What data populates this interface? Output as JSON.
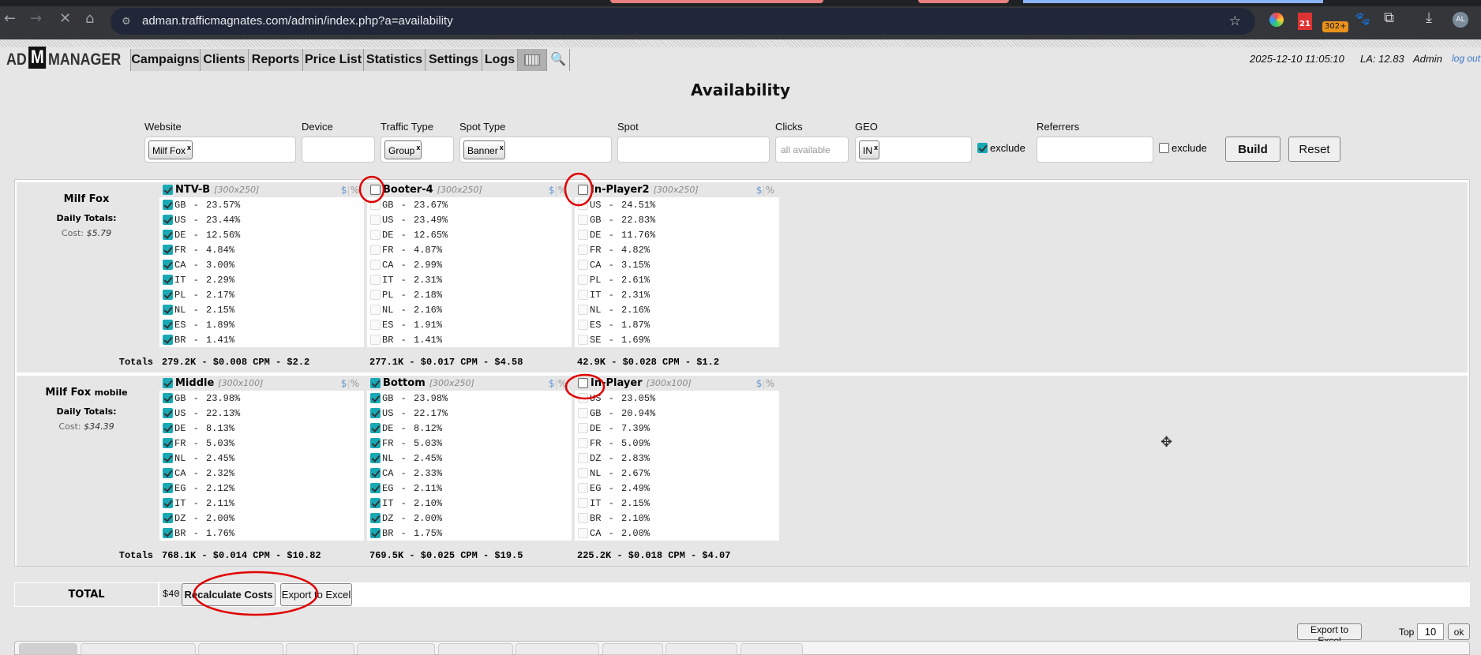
{
  "browser": {
    "url": "adman.trafficmagnates.com/admin/index.php?a=availability",
    "badge_calendar": "21",
    "badge_ext": "302+",
    "avatar": "AL"
  },
  "nav": {
    "logo": "AD M MANAGER",
    "logo_parts": [
      "AD",
      "M",
      "MANAGER"
    ],
    "items": [
      "Campaigns",
      "Clients",
      "Reports",
      "Price List",
      "Statistics",
      "Settings",
      "Logs"
    ],
    "datetime": "2025-12-10 11:05:10",
    "la": "LA: 12.83",
    "user": "Admin",
    "logout": "log out"
  },
  "page": {
    "title": "Availability"
  },
  "filters": {
    "website": {
      "label": "Website",
      "chip": "Milf Fox"
    },
    "device": {
      "label": "Device"
    },
    "traffic_type": {
      "label": "Traffic Type",
      "chip": "Group"
    },
    "spot_type": {
      "label": "Spot Type",
      "chip": "Banner"
    },
    "spot": {
      "label": "Spot"
    },
    "clicks": {
      "label": "Clicks",
      "placeholder": "all available"
    },
    "geo": {
      "label": "GEO",
      "chip": "IN",
      "exclude_label": "exclude",
      "exclude_checked": true
    },
    "referrers": {
      "label": "Referrers",
      "exclude_label": "exclude",
      "exclude_checked": false
    },
    "build": "Build",
    "reset": "Reset",
    "chip_remove": "x"
  },
  "labels": {
    "daily_totals": "Daily Totals:",
    "cost": "Cost:",
    "totals": "Totals",
    "dollar": "$",
    "percent": "%"
  },
  "sites": [
    {
      "name": "Milf Fox",
      "suffix": "",
      "cost": "$5.79",
      "spots": [
        {
          "name": "NTV-B",
          "size": "[300x250]",
          "checked": true,
          "totals": "279.2K - $0.008 CPM - $2.2",
          "items": [
            [
              "GB",
              "23.57%",
              1
            ],
            [
              "US",
              "23.44%",
              1
            ],
            [
              "DE",
              "12.56%",
              1
            ],
            [
              "FR",
              "4.84%",
              1
            ],
            [
              "CA",
              "3.00%",
              1
            ],
            [
              "IT",
              "2.29%",
              1
            ],
            [
              "PL",
              "2.17%",
              1
            ],
            [
              "NL",
              "2.15%",
              1
            ],
            [
              "ES",
              "1.89%",
              1
            ],
            [
              "BR",
              "1.41%",
              1
            ]
          ]
        },
        {
          "name": "Booter-4",
          "size": "[300x250]",
          "checked": false,
          "totals": "277.1K - $0.017 CPM - $4.58",
          "items": [
            [
              "GB",
              "23.67%",
              0
            ],
            [
              "US",
              "23.49%",
              0
            ],
            [
              "DE",
              "12.65%",
              0
            ],
            [
              "FR",
              "4.87%",
              0
            ],
            [
              "CA",
              "2.99%",
              0
            ],
            [
              "IT",
              "2.31%",
              0
            ],
            [
              "PL",
              "2.18%",
              0
            ],
            [
              "NL",
              "2.16%",
              0
            ],
            [
              "ES",
              "1.91%",
              0
            ],
            [
              "BR",
              "1.41%",
              0
            ]
          ]
        },
        {
          "name": "In-Player2",
          "size": "[300x250]",
          "checked": false,
          "totals": "42.9K - $0.028 CPM - $1.2",
          "items": [
            [
              "US",
              "24.51%",
              0
            ],
            [
              "GB",
              "22.83%",
              0
            ],
            [
              "DE",
              "11.76%",
              0
            ],
            [
              "FR",
              "4.82%",
              0
            ],
            [
              "CA",
              "3.15%",
              0
            ],
            [
              "PL",
              "2.61%",
              0
            ],
            [
              "IT",
              "2.31%",
              0
            ],
            [
              "NL",
              "2.16%",
              0
            ],
            [
              "ES",
              "1.87%",
              0
            ],
            [
              "SE",
              "1.69%",
              0
            ]
          ]
        }
      ]
    },
    {
      "name": "Milf Fox",
      "suffix": "mobile",
      "cost": "$34.39",
      "spots": [
        {
          "name": "Middle",
          "size": "[300x100]",
          "checked": true,
          "totals": "768.1K - $0.014 CPM - $10.82",
          "items": [
            [
              "GB",
              "23.98%",
              1
            ],
            [
              "US",
              "22.13%",
              1
            ],
            [
              "DE",
              "8.13%",
              1
            ],
            [
              "FR",
              "5.03%",
              1
            ],
            [
              "NL",
              "2.45%",
              1
            ],
            [
              "CA",
              "2.32%",
              1
            ],
            [
              "EG",
              "2.12%",
              1
            ],
            [
              "IT",
              "2.11%",
              1
            ],
            [
              "DZ",
              "2.00%",
              1
            ],
            [
              "BR",
              "1.76%",
              1
            ]
          ]
        },
        {
          "name": "Bottom",
          "size": "[300x250]",
          "checked": true,
          "totals": "769.5K - $0.025 CPM - $19.5",
          "items": [
            [
              "GB",
              "23.98%",
              1
            ],
            [
              "US",
              "22.17%",
              1
            ],
            [
              "DE",
              "8.12%",
              1
            ],
            [
              "FR",
              "5.03%",
              1
            ],
            [
              "NL",
              "2.45%",
              1
            ],
            [
              "CA",
              "2.33%",
              1
            ],
            [
              "EG",
              "2.11%",
              1
            ],
            [
              "IT",
              "2.10%",
              1
            ],
            [
              "DZ",
              "2.00%",
              1
            ],
            [
              "BR",
              "1.75%",
              1
            ]
          ]
        },
        {
          "name": "In-Player",
          "size": "[300x100]",
          "checked": false,
          "totals": "225.2K - $0.018 CPM - $4.07",
          "items": [
            [
              "US",
              "23.05%",
              0
            ],
            [
              "GB",
              "20.94%",
              0
            ],
            [
              "DE",
              "7.39%",
              0
            ],
            [
              "FR",
              "5.09%",
              0
            ],
            [
              "DZ",
              "2.83%",
              0
            ],
            [
              "NL",
              "2.67%",
              0
            ],
            [
              "EG",
              "2.49%",
              0
            ],
            [
              "IT",
              "2.15%",
              0
            ],
            [
              "BR",
              "2.10%",
              0
            ],
            [
              "CA",
              "2.00%",
              0
            ]
          ]
        }
      ]
    }
  ],
  "total": {
    "label": "TOTAL",
    "value": "$40.18",
    "recalculate": "Recalculate Costs",
    "export": "Export to Excel"
  },
  "bottom": {
    "export": "Export to Excel",
    "top_label": "Top",
    "top_value": "10",
    "ok": "ok"
  },
  "colors": {
    "checkbox_accent": "#19a9b5",
    "annotation": "#e00000",
    "link": "#3a78c9"
  }
}
